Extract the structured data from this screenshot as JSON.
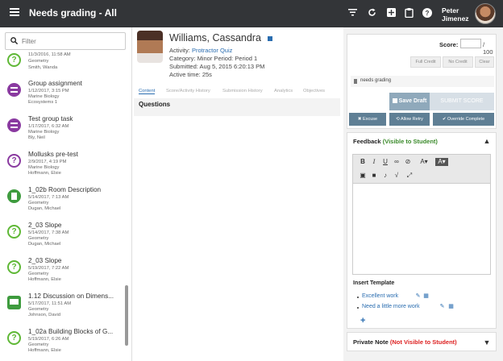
{
  "header": {
    "title": "Needs grading - All",
    "user_first": "Peter",
    "user_last": "Jimenez",
    "icons": [
      "filter-icon",
      "refresh-icon",
      "add-icon",
      "clipboard-icon",
      "help-icon"
    ]
  },
  "sidebar": {
    "search_placeholder": "Filter",
    "items": [
      {
        "title": "",
        "date": "11/3/2016, 11:58 AM",
        "course": "Geometry",
        "person": "Smith, Wanda",
        "icon": "question-icon",
        "color": "#5fb836"
      },
      {
        "title": "Group assignment",
        "date": "1/12/2017, 3:15 PM",
        "course": "Marine Biology",
        "person": "Ecosystems 1",
        "icon": "group-task-icon",
        "color": "#8a3aa0"
      },
      {
        "title": "Test group task",
        "date": "1/17/2017, 6:32 AM",
        "course": "Marine Biology",
        "person": "Bly, Neil",
        "icon": "group-task-icon",
        "color": "#8a3aa0"
      },
      {
        "title": "Mollusks pre-test",
        "date": "2/9/2017, 4:19 PM",
        "course": "Marine Biology",
        "person": "Hoffmann, Elsie",
        "icon": "question-icon",
        "color": "#8a3aa0"
      },
      {
        "title": "1_02b Room Description",
        "date": "5/14/2017, 7:13 AM",
        "course": "Geometry",
        "person": "Dugan, Michael",
        "icon": "document-icon",
        "color": "#3e9b3e"
      },
      {
        "title": "2_03 Slope",
        "date": "5/14/2017, 7:38 AM",
        "course": "Geometry",
        "person": "Dugan, Michael",
        "icon": "question-icon",
        "color": "#5fb836"
      },
      {
        "title": "2_03 Slope",
        "date": "5/19/2017, 7:22 AM",
        "course": "Geometry",
        "person": "Hoffmann, Elsie",
        "icon": "question-icon",
        "color": "#5fb836"
      },
      {
        "title": "1.12 Discussion on Dimens...",
        "date": "5/17/2017, 11:51 AM",
        "course": "Geometry",
        "person": "Johnson, David",
        "icon": "discussion-icon",
        "color": "#3e9b3e"
      },
      {
        "title": "1_02a Building Blocks of G...",
        "date": "5/19/2017, 6:26 AM",
        "course": "Geometry",
        "person": "Hoffmann, Elsie",
        "icon": "question-icon",
        "color": "#5fb836"
      }
    ]
  },
  "student": {
    "name": "Williams, Cassandra",
    "activity_label": "Activity:",
    "activity_link": "Protractor Quiz",
    "category_line": "Category: Minor   Period: Period 1",
    "submitted_line": "Submitted: Aug 5, 2015 6:20:13 PM",
    "active_line": "Active time: 25s"
  },
  "tabs": [
    "Content",
    "Score/Activity History",
    "Submission History",
    "Analytics",
    "Objectives"
  ],
  "questions_label": "Questions",
  "score": {
    "label": "Score:",
    "max": "/ 100",
    "value": "",
    "full_credit": "Full Credit",
    "no_credit": "No Credit",
    "clear": "Clear",
    "status": "needs grading",
    "save_draft": "Save Draft",
    "submit_score": "SUBMIT SCORE",
    "excuse": "Excuse",
    "allow_retry": "Allow Retry",
    "override_complete": "Override Complete"
  },
  "feedback": {
    "title": "Feedback",
    "visibility": "(Visible to Student)",
    "toolbar_row1": [
      "B",
      "I",
      "U",
      "link-icon",
      "unlink-icon",
      "text-color-icon",
      "highlight-icon"
    ],
    "toolbar_row2": [
      "image-icon",
      "video-icon",
      "microphone-icon",
      "math-icon",
      "fullscreen-icon"
    ],
    "insert_template_label": "Insert Template",
    "templates": [
      "Excellent work",
      "Need a little more work"
    ]
  },
  "private_note": {
    "title": "Private Note",
    "visibility": "(Not Visible to Student)"
  }
}
